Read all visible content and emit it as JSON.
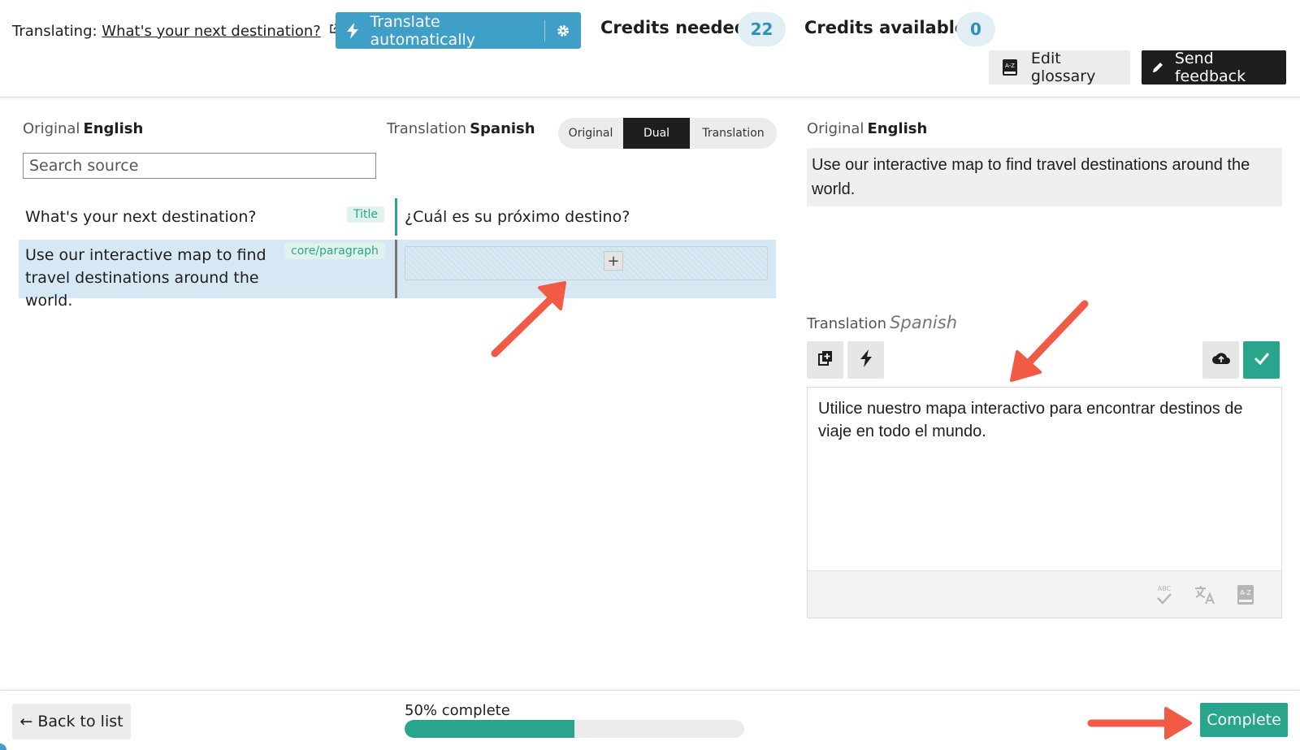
{
  "header": {
    "translating_label": "Translating:",
    "document_title": "What's your next destination?",
    "translate_button_label": "Translate automatically",
    "credits_needed_label": "Credits needed",
    "credits_needed": "22",
    "credits_available_label": "Credits available",
    "credits_available": "0",
    "edit_glossary_label": "Edit glossary",
    "send_feedback_label": "Send feedback"
  },
  "left_pane": {
    "original_label": "Original",
    "original_language": "English",
    "translation_label": "Translation",
    "translation_language": "Spanish",
    "search_placeholder": "Search source",
    "view_toggle": {
      "options": [
        "Original",
        "Dual",
        "Translation"
      ],
      "selected": "Dual"
    },
    "rows": [
      {
        "source": "What's your next destination?",
        "tag": "Title",
        "translation": "¿Cuál es su próximo destino?"
      },
      {
        "source": "Use our interactive map to find travel destinations around the world.",
        "tag": "core/paragraph",
        "translation": ""
      }
    ],
    "add_translation_symbol": "+"
  },
  "right_pane": {
    "original_label": "Original",
    "original_language": "English",
    "original_text": "Use our interactive map to find travel destinations around the world.",
    "translation_label": "Translation",
    "translation_language": "Spanish",
    "translation_text": "Utilice nuestro mapa interactivo para encontrar destinos de viaje en todo el mundo.",
    "toolbar_icons": [
      "copy-original-icon",
      "machine-translate-icon",
      "cloud-save-icon",
      "check-icon"
    ],
    "footer_icons": [
      "spellcheck-icon",
      "translate-language-icon",
      "glossary-icon"
    ]
  },
  "footer": {
    "back_label": "← Back to list",
    "progress_label": "50% complete",
    "progress_percent": 50,
    "complete_label": "Complete"
  },
  "colors": {
    "accent_blue": "#3f9fc6",
    "accent_green": "#2aa58d",
    "selected_row": "#d5e8f4",
    "annotation_arrow": "#f15a45"
  }
}
